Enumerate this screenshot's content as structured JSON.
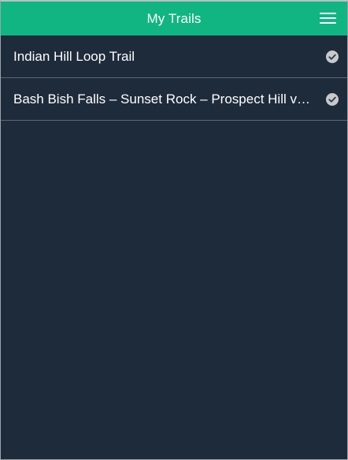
{
  "header": {
    "title": "My Trails",
    "menu_icon": "hamburger-menu-icon"
  },
  "trails": [
    {
      "name": "Indian Hill Loop Trail",
      "status_icon": "check-circle-icon"
    },
    {
      "name": "Bash Bish Falls – Sunset Rock – Prospect Hill via ...",
      "status_icon": "check-circle-icon"
    }
  ],
  "colors": {
    "header_bg": "#10b582",
    "page_bg": "#1e2b3b",
    "text": "#ffffff",
    "check_icon": "#c7c9cc"
  }
}
